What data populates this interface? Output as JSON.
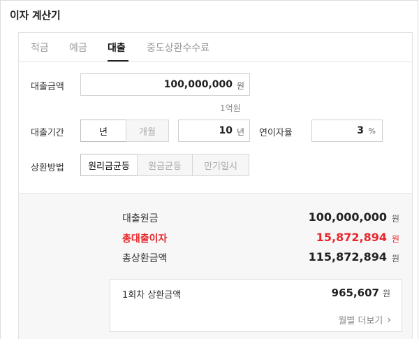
{
  "title": "이자 계산기",
  "tabs": [
    {
      "label": "적금"
    },
    {
      "label": "예금"
    },
    {
      "label": "대출"
    },
    {
      "label": "중도상환수수료"
    }
  ],
  "form": {
    "amount_label": "대출금액",
    "amount_value": "100,000,000",
    "amount_unit": "원",
    "amount_hint": "1억원",
    "period_label": "대출기간",
    "period_units": [
      "년",
      "개월"
    ],
    "period_selected": "년",
    "period_value": "10",
    "period_unit": "년",
    "rate_label": "연이자율",
    "rate_value": "3",
    "rate_unit": "%",
    "method_label": "상환방법",
    "methods": [
      "원리금균등",
      "원금균등",
      "만기일시"
    ],
    "method_selected": "원리금균등"
  },
  "result": {
    "principal_label": "대출원금",
    "principal_value": "100,000,000",
    "principal_unit": "원",
    "interest_label": "총대출이자",
    "interest_value": "15,872,894",
    "interest_unit": "원",
    "total_label": "총상환금액",
    "total_value": "115,872,894",
    "total_unit": "원",
    "installment_label": "1회차 상환금액",
    "installment_value": "965,607",
    "installment_unit": "원",
    "more_label": "월별 더보기"
  },
  "colors": {
    "accent_red": "#e8272c"
  }
}
